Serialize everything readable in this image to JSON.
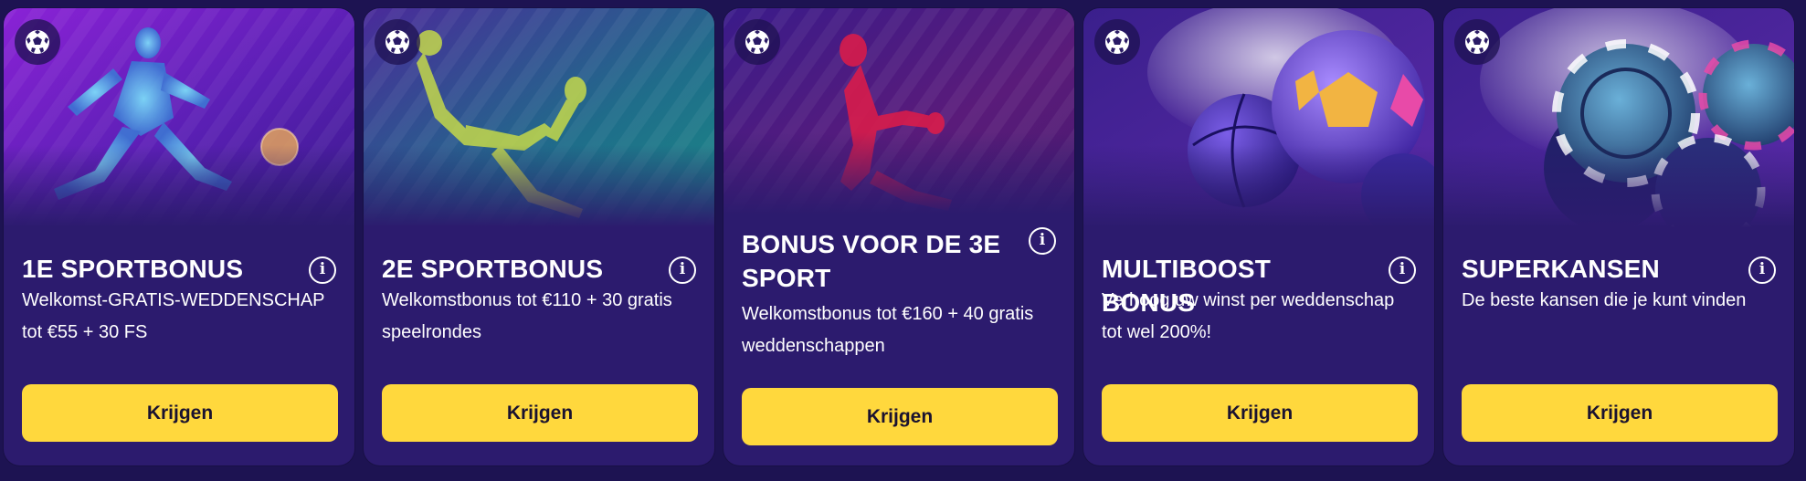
{
  "cards": [
    {
      "title": "1E SPORTBONUS",
      "description": "Welkomst-GRATIS-WEDDENSCHAP tot €55 + 30 FS",
      "button_label": "Krijgen",
      "icon": "soccer-ball-icon",
      "info_icon": "info-icon"
    },
    {
      "title": "2E SPORTBONUS",
      "description": "Welkomstbonus tot €110 + 30 gratis speelrondes",
      "button_label": "Krijgen",
      "icon": "soccer-ball-icon",
      "info_icon": "info-icon"
    },
    {
      "title": "BONUS VOOR DE 3E SPORT",
      "description": "Welkomstbonus tot €160 + 40 gratis weddenschappen",
      "button_label": "Krijgen",
      "icon": "soccer-ball-icon",
      "info_icon": "info-icon"
    },
    {
      "title": "MULTIBOOST BONUS",
      "description": "Verhoog uw winst per weddenschap tot wel 200%!",
      "button_label": "Krijgen",
      "icon": "soccer-ball-icon",
      "info_icon": "info-icon"
    },
    {
      "title": "SUPERKANSEN",
      "description": "De beste kansen die je kunt vinden",
      "button_label": "Krijgen",
      "icon": "soccer-ball-icon",
      "info_icon": "info-icon"
    }
  ],
  "colors": {
    "page_background": "#1d1352",
    "card_background": "#2c1b6e",
    "button": "#ffd83d",
    "button_text": "#1a1230",
    "text": "#ffffff"
  }
}
